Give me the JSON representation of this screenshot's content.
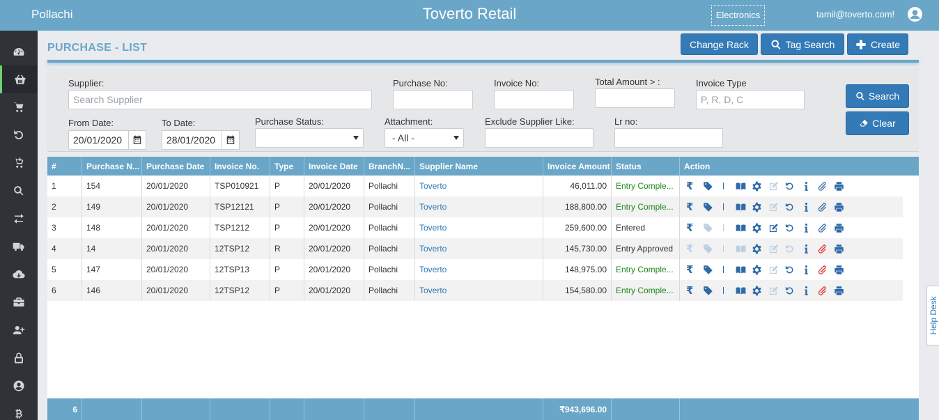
{
  "header": {
    "branch": "Pollachi",
    "app_title": "Toverto Retail",
    "category": "Electronics",
    "user_email": "tamil@toverto.com!"
  },
  "page": {
    "title": "PURCHASE - LIST",
    "buttons": {
      "change_rack": "Change Rack",
      "tag_search": "Tag Search",
      "create": "Create"
    }
  },
  "filters": {
    "supplier": {
      "label": "Supplier:",
      "placeholder": "Search Supplier"
    },
    "purchase_no": {
      "label": "Purchase No:",
      "value": ""
    },
    "invoice_no": {
      "label": "Invoice No:",
      "value": ""
    },
    "total_amount": {
      "label": "Total Amount > :",
      "value": ""
    },
    "invoice_type": {
      "label": "Invoice Type",
      "placeholder": "P, R, D, C"
    },
    "from_date": {
      "label": "From Date:",
      "value": "20/01/2020"
    },
    "to_date": {
      "label": "To Date:",
      "value": "28/01/2020"
    },
    "purchase_status": {
      "label": "Purchase Status:",
      "value": ""
    },
    "attachment": {
      "label": "Attachment:",
      "value": "- All -"
    },
    "exclude_supplier": {
      "label": "Exclude Supplier Like:",
      "value": ""
    },
    "lr_no": {
      "label": "Lr no:",
      "value": ""
    },
    "search_button": "Search",
    "clear_button": "Clear"
  },
  "table": {
    "columns": [
      "#",
      "Purchase N...",
      "Purchase Date",
      "Invoice No.",
      "Type",
      "Invoice Date",
      "BranchN...",
      "Supplier Name",
      "Invoice Amount",
      "Status",
      "Action"
    ],
    "rows": [
      {
        "no": "1",
        "purchase_no": "154",
        "purchase_date": "20/01/2020",
        "invoice_no": "TSP010921",
        "type": "P",
        "invoice_date": "20/01/2020",
        "branch": "Pollachi",
        "supplier": "Toverto",
        "amount": "46,011.00",
        "status": "Entry Comple...",
        "status_color": "#1b8a1b"
      },
      {
        "no": "2",
        "purchase_no": "149",
        "purchase_date": "20/01/2020",
        "invoice_no": "TSP12121",
        "type": "P",
        "invoice_date": "20/01/2020",
        "branch": "Pollachi",
        "supplier": "Toverto",
        "amount": "188,800.00",
        "status": "Entry Comple...",
        "status_color": "#1b8a1b"
      },
      {
        "no": "3",
        "purchase_no": "148",
        "purchase_date": "20/01/2020",
        "invoice_no": "TSP1212",
        "type": "P",
        "invoice_date": "20/01/2020",
        "branch": "Pollachi",
        "supplier": "Toverto",
        "amount": "259,600.00",
        "status": "Entered",
        "status_color": "#333333"
      },
      {
        "no": "4",
        "purchase_no": "14",
        "purchase_date": "20/01/2020",
        "invoice_no": "12TSP12",
        "type": "R",
        "invoice_date": "20/01/2020",
        "branch": "Pollachi",
        "supplier": "Toverto",
        "amount": "145,730.00",
        "status": "Entry Approved",
        "status_color": "#333333"
      },
      {
        "no": "5",
        "purchase_no": "147",
        "purchase_date": "20/01/2020",
        "invoice_no": "12TSP13",
        "type": "P",
        "invoice_date": "20/01/2020",
        "branch": "Pollachi",
        "supplier": "Toverto",
        "amount": "148,975.00",
        "status": "Entry Comple...",
        "status_color": "#1b8a1b"
      },
      {
        "no": "6",
        "purchase_no": "146",
        "purchase_date": "20/01/2020",
        "invoice_no": "12TSP12",
        "type": "P",
        "invoice_date": "20/01/2020",
        "branch": "Pollachi",
        "supplier": "Toverto",
        "amount": "154,580.00",
        "status": "Entry Comple...",
        "status_color": "#1b8a1b"
      }
    ],
    "footer": {
      "count": "6",
      "total_amount": "₹943,696.00"
    }
  },
  "help_desk": "Help Desk",
  "colors": {
    "primary": "#6aa6c8",
    "button": "#337ab7",
    "sidebar": "#2f3338",
    "accent_green": "#6fd16f"
  }
}
